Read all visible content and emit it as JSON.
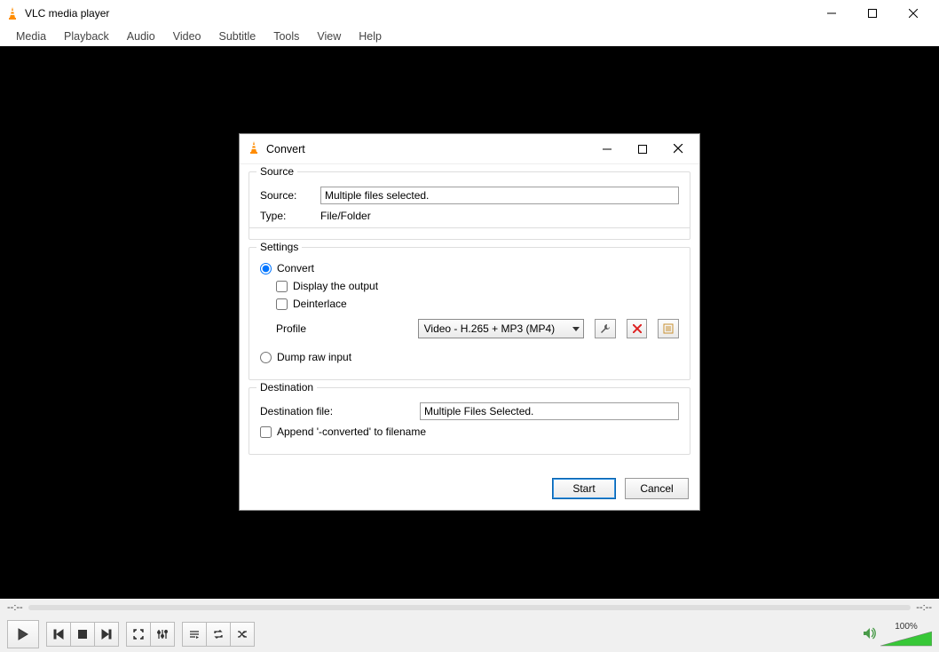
{
  "main": {
    "title": "VLC media player",
    "menus": [
      "Media",
      "Playback",
      "Audio",
      "Video",
      "Subtitle",
      "Tools",
      "View",
      "Help"
    ],
    "time_elapsed": "--:--",
    "time_total": "--:--",
    "volume_pct": "100%"
  },
  "dialog": {
    "title": "Convert",
    "source": {
      "legend": "Source",
      "source_label": "Source:",
      "source_value": "Multiple files selected.",
      "type_label": "Type:",
      "type_value": "File/Folder"
    },
    "settings": {
      "legend": "Settings",
      "convert_label": "Convert",
      "display_output_label": "Display the output",
      "deinterlace_label": "Deinterlace",
      "profile_label": "Profile",
      "profile_value": "Video - H.265 + MP3 (MP4)",
      "dump_raw_label": "Dump raw input"
    },
    "destination": {
      "legend": "Destination",
      "dest_file_label": "Destination file:",
      "dest_file_value": "Multiple Files Selected.",
      "append_label": "Append '-converted' to filename"
    },
    "buttons": {
      "start": "Start",
      "cancel": "Cancel"
    }
  }
}
